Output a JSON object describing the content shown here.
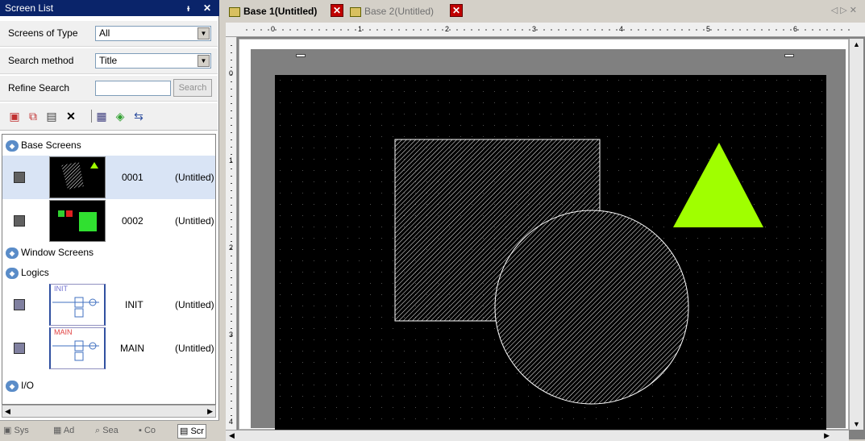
{
  "panel": {
    "title": "Screen List",
    "pin": "ᵻ",
    "close": "✕",
    "screens_of_type_label": "Screens of Type",
    "screens_of_type_value": "All",
    "search_method_label": "Search method",
    "search_method_value": "Title",
    "refine_label": "Refine Search",
    "refine_value": "",
    "search_button": "Search"
  },
  "tree": {
    "groups": {
      "base": "Base Screens",
      "window": "Window Screens",
      "logics": "Logics",
      "io": "I/O"
    },
    "base_screens": [
      {
        "number": "0001",
        "title": "(Untitled)"
      },
      {
        "number": "0002",
        "title": "(Untitled)"
      }
    ],
    "logics": [
      {
        "number": "INIT",
        "title": "(Untitled)",
        "tag": "INIT"
      },
      {
        "number": "MAIN",
        "title": "(Untitled)",
        "tag": "MAIN"
      }
    ]
  },
  "bottom_tabs": [
    "Sys",
    "Ad",
    "Sea",
    "Co",
    "Scr"
  ],
  "doc_tabs": [
    {
      "label": "Base 1(Untitled)",
      "active": true
    },
    {
      "label": "Base 2(Untitled)",
      "active": false
    }
  ],
  "ruler": {
    "top": [
      "0",
      "1",
      "2",
      "3",
      "4",
      "5",
      "6"
    ],
    "left": [
      "0",
      "1",
      "2",
      "3",
      "4"
    ]
  },
  "colors": {
    "triangle": "#a0ff00",
    "hatch": "#ffffff",
    "screen_bg": "#000000"
  }
}
